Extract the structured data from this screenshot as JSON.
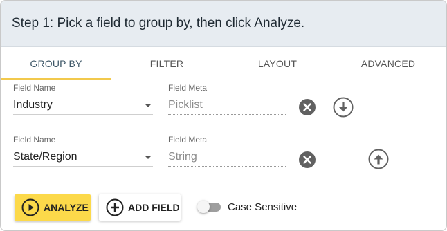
{
  "header": {
    "title": "Step 1: Pick a field to group by, then click Analyze."
  },
  "tabs": [
    {
      "label": "GROUP BY",
      "active": true
    },
    {
      "label": "FILTER",
      "active": false
    },
    {
      "label": "LAYOUT",
      "active": false
    },
    {
      "label": "ADVANCED",
      "active": false
    }
  ],
  "rows": [
    {
      "field_name_label": "Field Name",
      "field_name_value": "Industry",
      "field_meta_label": "Field Meta",
      "field_meta_value": "Picklist",
      "remove_icon": "close-circle-icon",
      "move_icon": "arrow-down-circle-icon"
    },
    {
      "field_name_label": "Field Name",
      "field_name_value": "State/Region",
      "field_meta_label": "Field Meta",
      "field_meta_value": "String",
      "remove_icon": "close-circle-icon",
      "move_icon": "arrow-up-circle-icon"
    }
  ],
  "actions": {
    "analyze_label": "ANALYZE",
    "add_field_label": "ADD FIELD",
    "case_sensitive_label": "Case Sensitive",
    "case_sensitive_on": false
  },
  "colors": {
    "accent": "#fcd94a",
    "header_bg": "#e7ecf1",
    "tab_indicator": "#f2c94c"
  }
}
